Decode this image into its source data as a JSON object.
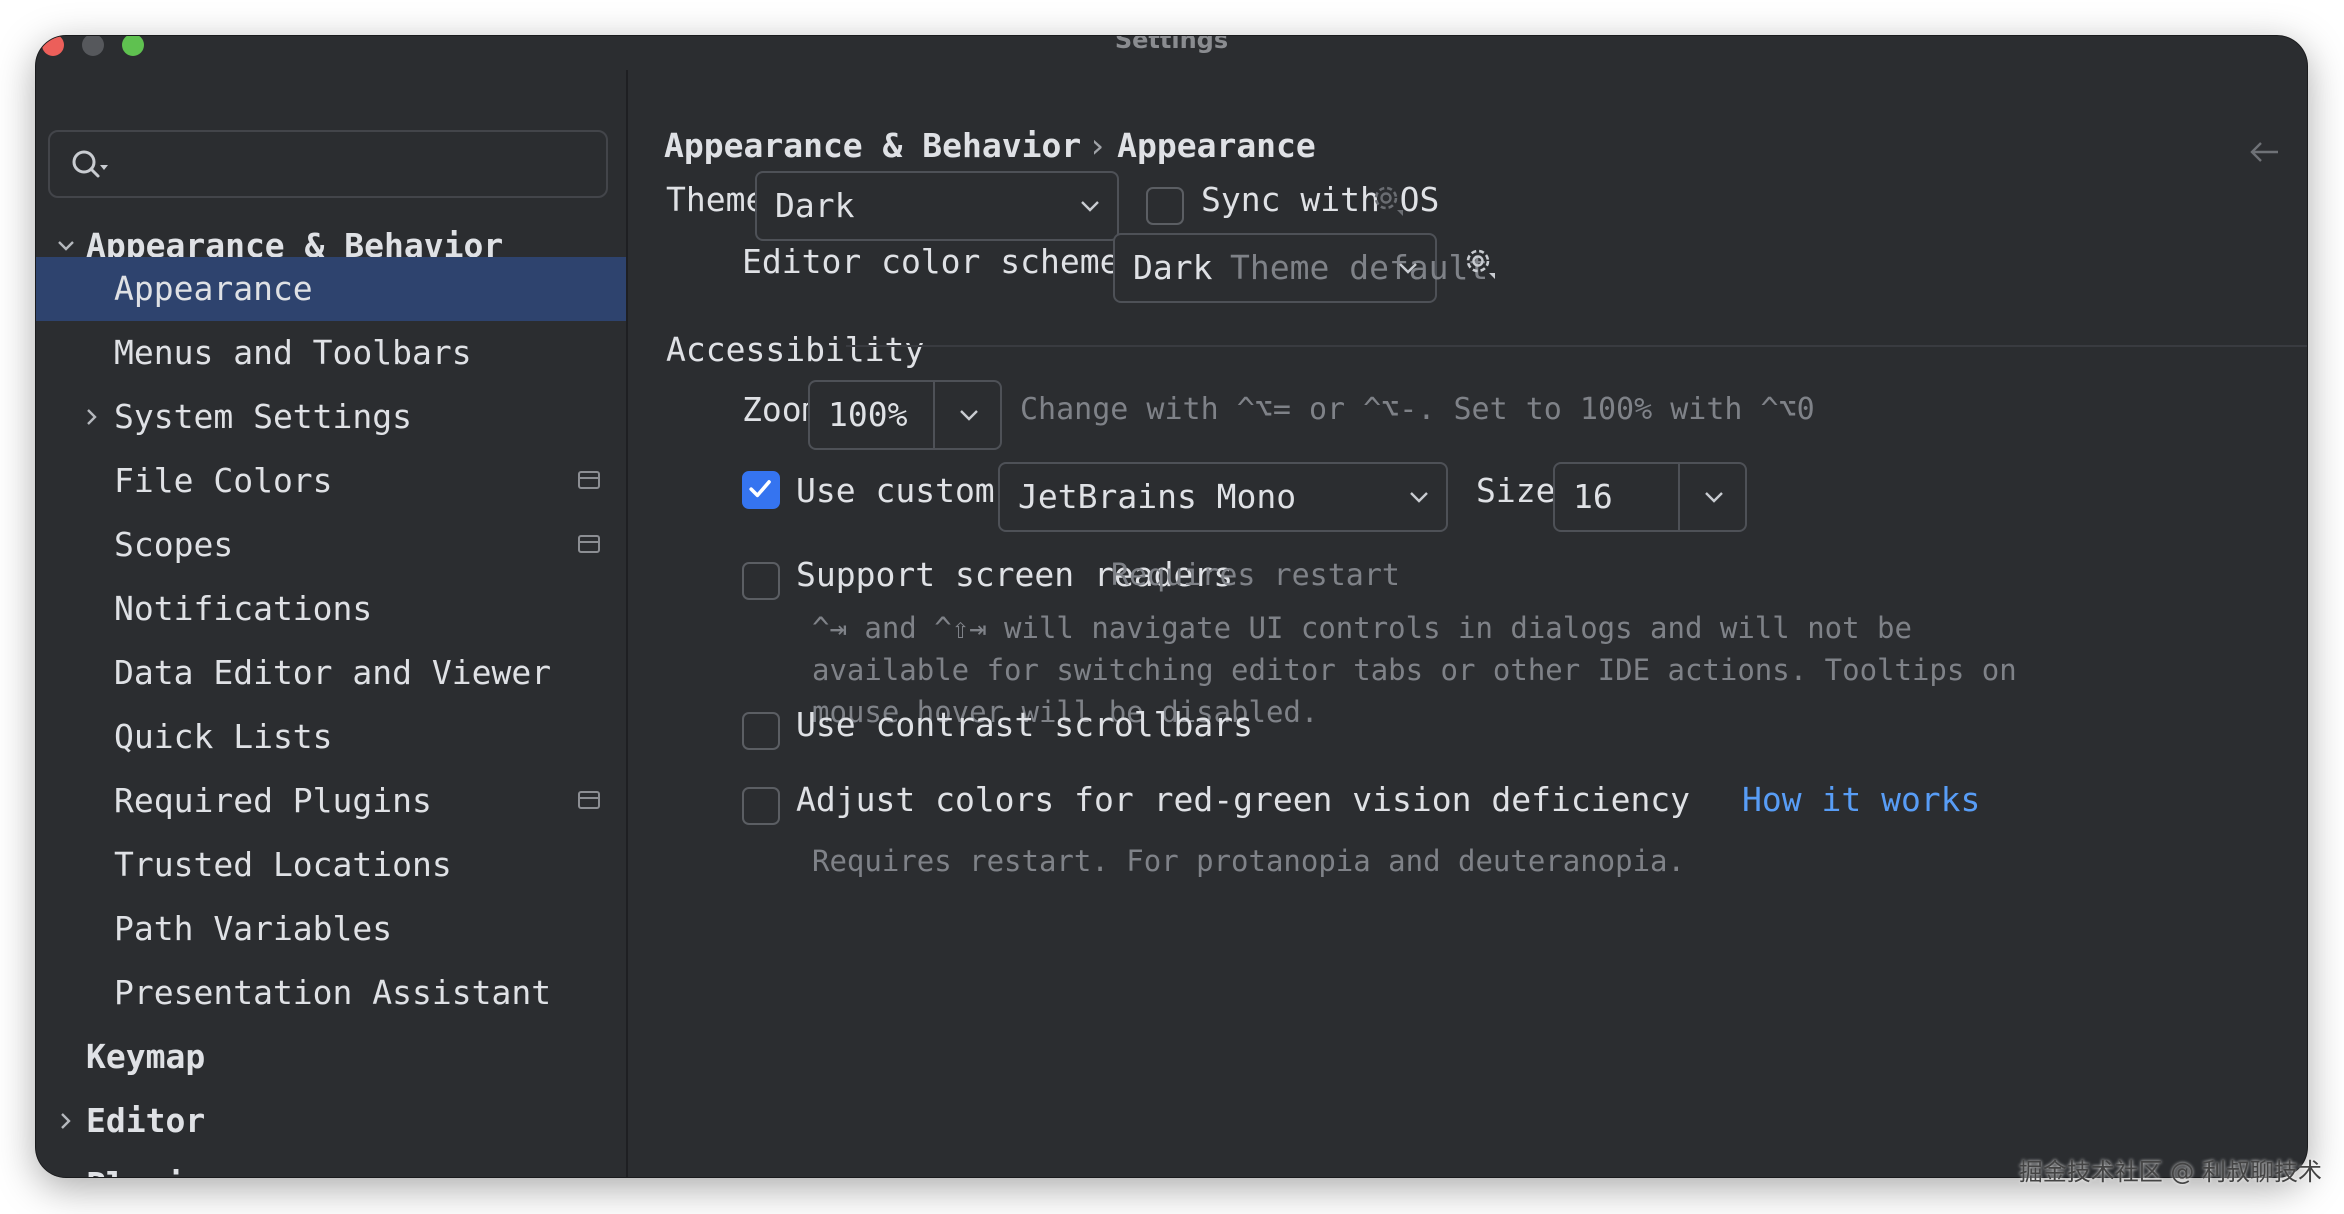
{
  "window": {
    "title": "Settings"
  },
  "sidebar": {
    "search": {
      "placeholder": ""
    },
    "items": [
      {
        "label": "Appearance & Behavior",
        "expanded": true
      },
      {
        "label": "Appearance",
        "selected": true
      },
      {
        "label": "Menus and Toolbars"
      },
      {
        "label": "System Settings"
      },
      {
        "label": "File Colors"
      },
      {
        "label": "Scopes"
      },
      {
        "label": "Notifications"
      },
      {
        "label": "Data Editor and Viewer"
      },
      {
        "label": "Quick Lists"
      },
      {
        "label": "Required Plugins"
      },
      {
        "label": "Trusted Locations"
      },
      {
        "label": "Path Variables"
      },
      {
        "label": "Presentation Assistant"
      },
      {
        "label": "Keymap"
      },
      {
        "label": "Editor"
      },
      {
        "label": "Plugins"
      }
    ]
  },
  "breadcrumb": {
    "parent": "Appearance & Behavior",
    "separator": "›",
    "current": "Appearance"
  },
  "theme": {
    "label": "Theme:",
    "value": "Dark",
    "sync_label": "Sync with OS",
    "sync_checked": false
  },
  "editor_scheme": {
    "label": "Editor color scheme:",
    "value": "Dark",
    "hint": "Theme default"
  },
  "accessibility": {
    "title": "Accessibility",
    "zoom_label": "Zoom:",
    "zoom_value": "100%",
    "zoom_hint": "Change with ^⌥= or ^⌥-. Set to 100% with ^⌥0",
    "custom_font_label": "Use custom font:",
    "custom_font_checked": true,
    "font_value": "JetBrains Mono",
    "size_label": "Size:",
    "size_value": "16",
    "screen_readers_label": "Support screen readers",
    "screen_readers_hint": "Requires restart",
    "screen_readers_desc": "^⇥ and ^⇧⇥ will navigate UI controls in dialogs and will not be\navailable for switching editor tabs or other IDE actions. Tooltips on\nmouse hover will be disabled.",
    "contrast_label": "Use contrast scrollbars",
    "colors_label": "Adjust colors for red-green vision deficiency",
    "colors_link": "How it works",
    "colors_desc": "Requires restart. For protanopia and deuteranopia."
  },
  "watermark": "掘金技术社区 @ 利叔聊技术",
  "colors": {
    "accent": "#3574f0",
    "selection": "#2e436e",
    "link": "#589df6",
    "background": "#2b2d30"
  }
}
